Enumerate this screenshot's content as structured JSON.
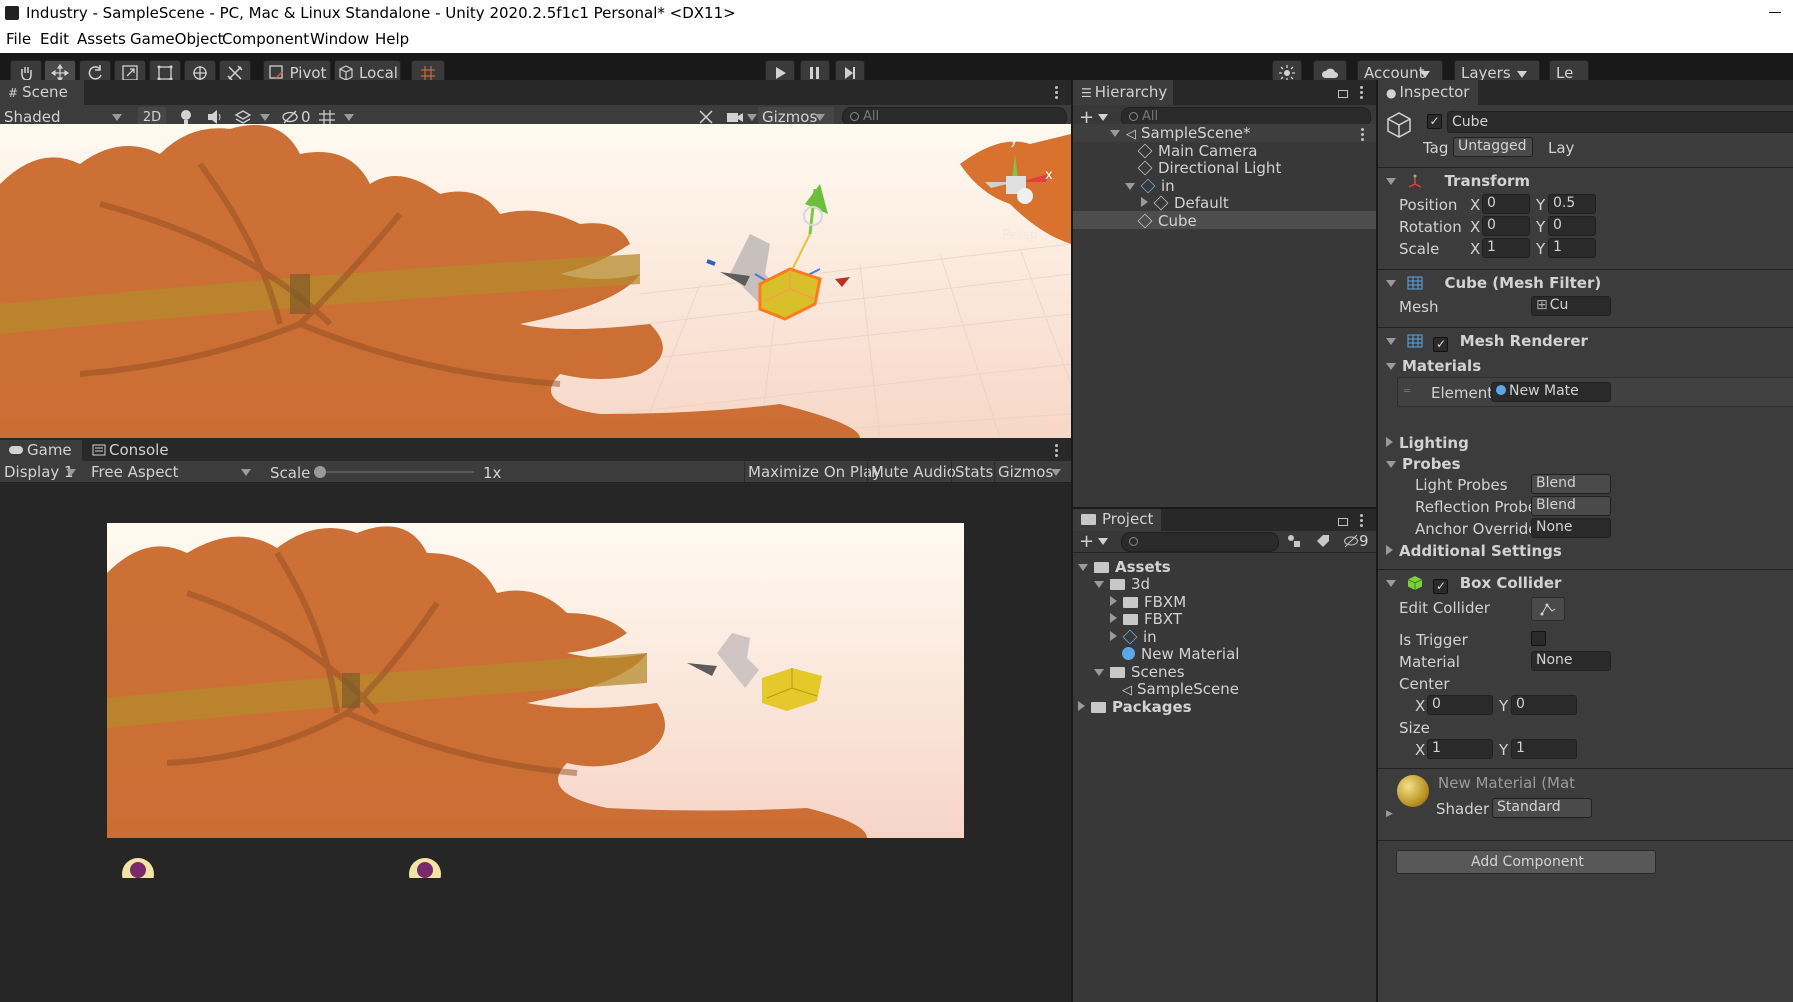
{
  "window": {
    "title": "Industry - SampleScene - PC, Mac & Linux Standalone - Unity 2020.2.5f1c1 Personal* <DX11>"
  },
  "menu": [
    "File",
    "Edit",
    "Assets",
    "GameObject",
    "Component",
    "Window",
    "Help"
  ],
  "toolbar": {
    "pivot": "Pivot",
    "local": "Local",
    "account": "Account",
    "layers": "Layers",
    "layout": "Le"
  },
  "scene": {
    "tab": "Scene",
    "shading": "Shaded",
    "mode2d": "2D",
    "hidden_count": "0",
    "gizmos": "Gizmos",
    "search_placeholder": "All",
    "persp": "Persp",
    "axis_y": "y",
    "axis_x": "x"
  },
  "game": {
    "tab_game": "Game",
    "tab_console": "Console",
    "display": "Display 1",
    "aspect": "Free Aspect",
    "scale_label": "Scale",
    "scale_value": "1x",
    "scale_fraction": 0.0,
    "maximize": "Maximize On Play",
    "mute": "Mute Audio",
    "stats": "Stats",
    "gizmos": "Gizmos"
  },
  "hierarchy": {
    "tab": "Hierarchy",
    "search_placeholder": "All",
    "items": [
      "SampleScene*",
      "Main Camera",
      "Directional Light",
      "in",
      "Default",
      "Cube"
    ]
  },
  "project": {
    "tab": "Project",
    "hidden_count": "9",
    "items": [
      "Assets",
      "3d",
      "FBXM",
      "FBXT",
      "in",
      "New Material",
      "Scenes",
      "SampleScene",
      "Packages"
    ]
  },
  "inspector": {
    "tab": "Inspector",
    "object_name": "Cube",
    "tag_label": "Tag",
    "tag_value": "Untagged",
    "layer_label": "Lay",
    "transform": {
      "title": "Transform",
      "position": {
        "label": "Position",
        "x": "0",
        "y": "0.5"
      },
      "rotation": {
        "label": "Rotation",
        "x": "0",
        "y": "0"
      },
      "scale": {
        "label": "Scale",
        "x": "1",
        "y": "1"
      }
    },
    "mesh_filter": {
      "title": "Cube (Mesh Filter)",
      "mesh_label": "Mesh",
      "mesh_value": "Cu"
    },
    "mesh_renderer": {
      "title": "Mesh Renderer",
      "materials": "Materials",
      "element_label": "Element (",
      "element_value": "New Mate",
      "lighting": "Lighting",
      "probes": "Probes",
      "light_probes": "Light Probes",
      "light_probes_value": "Blend",
      "reflection_probes": "Reflection Probes",
      "reflection_probes_value": "Blend",
      "anchor_override": "Anchor Override",
      "anchor_override_value": "None",
      "additional": "Additional Settings"
    },
    "box_collider": {
      "title": "Box Collider",
      "edit": "Edit Collider",
      "trigger": "Is Trigger",
      "material": "Material",
      "material_value": "None",
      "center": "Center",
      "center_x": "0",
      "center_y": "0",
      "size": "Size",
      "size_x": "1",
      "size_y": "1"
    },
    "material": {
      "name": "New Material (Mat",
      "shader_label": "Shader",
      "shader_value": "Standard"
    },
    "add_component": "Add Component"
  },
  "colors": {
    "accent": "#f08a3a",
    "leaf": "#c8652a",
    "sky": "#fdf0e4",
    "bg": "#383838"
  }
}
